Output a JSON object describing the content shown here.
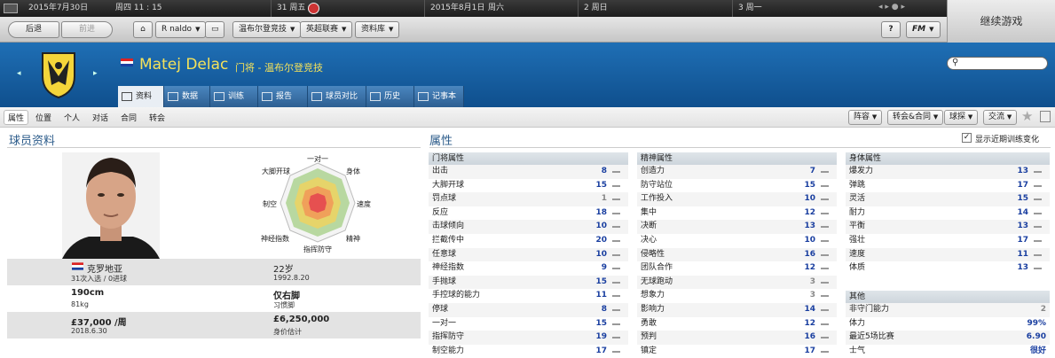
{
  "datebar": {
    "date1": "2015年7月30日",
    "day1": "周四 11 : 15",
    "seg2": "31 周五",
    "date2": "2015年8月1日",
    "day2": "周六",
    "seg4": "2 周日",
    "seg5": "3 周一"
  },
  "continue_label": "继续游戏",
  "nav": {
    "back": "后退",
    "forward": "前进",
    "player_menu": "R naldo",
    "club_menu": "温布尔登竞技",
    "league_menu": "英超联赛",
    "db_menu": "资料库",
    "help": "?",
    "fm": "FM"
  },
  "player": {
    "name": "Matej Delac",
    "position_club": "门将 - 温布尔登竞技",
    "nationality": "克罗地亚",
    "caps": "31次入选 / 0进球",
    "height": "190cm",
    "weight": "81kg",
    "wage": "£37,000 /周",
    "contract": "2018.6.30",
    "age": "22岁",
    "dob": "1992.8.20",
    "foot": "仅右脚",
    "foot_label": "习惯脚",
    "value": "£6,250,000",
    "value_label": "身价估计"
  },
  "tabs": [
    "资料",
    "数据",
    "训练",
    "报告",
    "球员对比",
    "历史",
    "记事本"
  ],
  "subtabs": [
    "属性",
    "位置",
    "个人",
    "对话",
    "合同",
    "转会"
  ],
  "sub_buttons": [
    "阵容",
    "转会&合同",
    "球探",
    "交流"
  ],
  "left_title": "球员资料",
  "right_title": "属性",
  "show_training": "显示近期训练变化",
  "radar_labels": {
    "top": "一对一",
    "top_right": "身体",
    "right": "速度",
    "bottom_right": "精神",
    "bottom": "指挥防守",
    "bottom_left": "神经指数",
    "left": "制空",
    "top_left": "大脚开球"
  },
  "gk": {
    "header": "门将属性",
    "rows": [
      {
        "name": "出击",
        "value": "8"
      },
      {
        "name": "大脚开球",
        "value": "15"
      },
      {
        "name": "罚点球",
        "value": "1"
      },
      {
        "name": "反应",
        "value": "18"
      },
      {
        "name": "击球倾向",
        "value": "10"
      },
      {
        "name": "拦截传中",
        "value": "20"
      },
      {
        "name": "任意球",
        "value": "10"
      },
      {
        "name": "神经指数",
        "value": "9"
      },
      {
        "name": "手抛球",
        "value": "15"
      },
      {
        "name": "手控球的能力",
        "value": "11"
      },
      {
        "name": "停球",
        "value": "8"
      },
      {
        "name": "一对一",
        "value": "15"
      },
      {
        "name": "指挥防守",
        "value": "19"
      },
      {
        "name": "制空能力",
        "value": "17"
      }
    ]
  },
  "mental": {
    "header": "精神属性",
    "rows": [
      {
        "name": "创造力",
        "value": "7"
      },
      {
        "name": "防守站位",
        "value": "15"
      },
      {
        "name": "工作投入",
        "value": "10"
      },
      {
        "name": "集中",
        "value": "12"
      },
      {
        "name": "决断",
        "value": "13"
      },
      {
        "name": "决心",
        "value": "10"
      },
      {
        "name": "侵略性",
        "value": "16"
      },
      {
        "name": "团队合作",
        "value": "12"
      },
      {
        "name": "无球跑动",
        "value": "3"
      },
      {
        "name": "想象力",
        "value": "3"
      },
      {
        "name": "影响力",
        "value": "14"
      },
      {
        "name": "勇敢",
        "value": "12"
      },
      {
        "name": "预判",
        "value": "16"
      },
      {
        "name": "镇定",
        "value": "17"
      }
    ]
  },
  "physical": {
    "header": "身体属性",
    "rows": [
      {
        "name": "爆发力",
        "value": "13"
      },
      {
        "name": "弹跳",
        "value": "17"
      },
      {
        "name": "灵活",
        "value": "15"
      },
      {
        "name": "耐力",
        "value": "14"
      },
      {
        "name": "平衡",
        "value": "13"
      },
      {
        "name": "强壮",
        "value": "17"
      },
      {
        "name": "速度",
        "value": "11"
      },
      {
        "name": "体质",
        "value": "13"
      }
    ]
  },
  "other": {
    "header": "其他",
    "rows": [
      {
        "name": "非守门能力",
        "value": "2"
      },
      {
        "name": "体力",
        "value": "99%"
      },
      {
        "name": "最近5场比赛",
        "value": "6.90"
      },
      {
        "name": "士气",
        "value": "很好"
      }
    ]
  },
  "colors": {
    "header_blue": "#1a64a8",
    "name_yellow": "#f5e25a",
    "value_blue": "#1a3fa0"
  }
}
